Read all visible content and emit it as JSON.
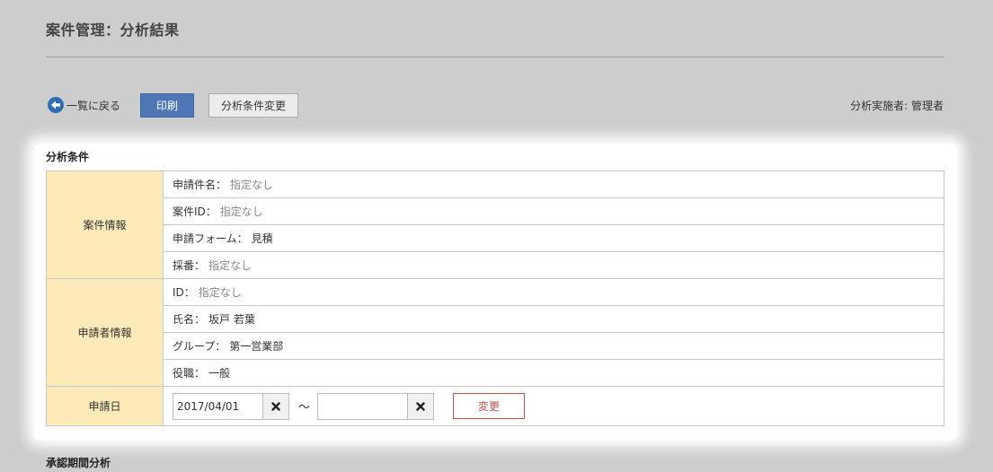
{
  "page": {
    "title": "案件管理：分析結果"
  },
  "toolbar": {
    "back_label": "一覧に戻る",
    "print_label": "印刷",
    "change_conditions_label": "分析条件変更",
    "analyst_text": "分析実施者: 管理者"
  },
  "conditions": {
    "section_title": "分析条件",
    "case_info": {
      "header": "案件情報",
      "rows": [
        {
          "label": "申請件名：",
          "value": "指定なし"
        },
        {
          "label": "案件ID：",
          "value": "指定なし"
        },
        {
          "label": "申請フォーム：",
          "value": "見積"
        },
        {
          "label": "採番：",
          "value": "指定なし"
        }
      ]
    },
    "applicant_info": {
      "header": "申請者情報",
      "rows": [
        {
          "label": "ID：",
          "value": "指定なし"
        },
        {
          "label": "氏名：",
          "value": "坂戸 若葉"
        },
        {
          "label": "グループ：",
          "value": "第一営業部"
        },
        {
          "label": "役職：",
          "value": "一般"
        }
      ]
    },
    "apply_date": {
      "header": "申請日",
      "from_value": "2017/04/01",
      "to_value": "",
      "separator": "～",
      "change_label": "変更"
    }
  },
  "next_section": {
    "title": "承認期間分析"
  },
  "colors": {
    "accent": "#4f77b5",
    "header_bg": "#fcebb9",
    "danger": "#c0504d",
    "page_bg": "#cdcdcd"
  }
}
